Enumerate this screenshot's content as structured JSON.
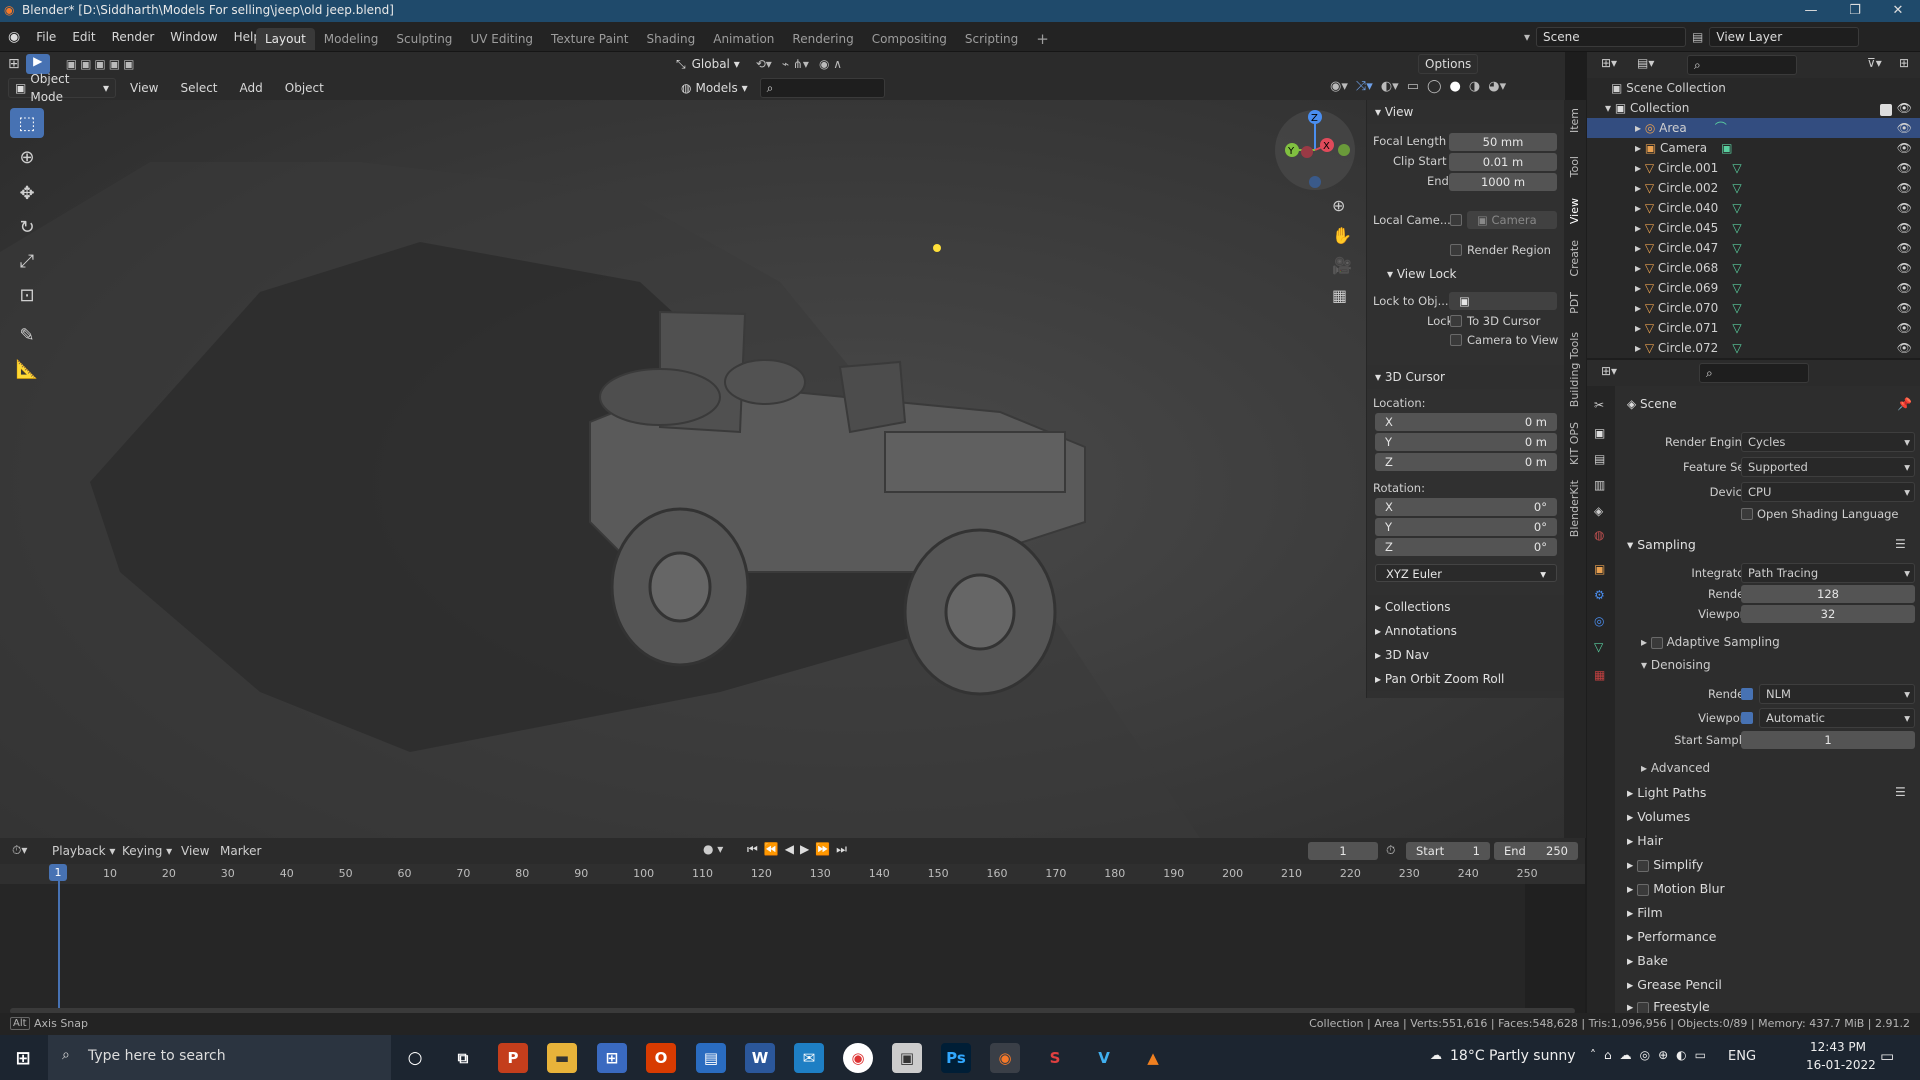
{
  "window": {
    "title": "Blender* [D:\\Siddharth\\Models For selling\\jeep\\old jeep.blend]"
  },
  "menu": [
    "File",
    "Edit",
    "Render",
    "Window",
    "Help"
  ],
  "workspaces": [
    "Layout",
    "Modeling",
    "Sculpting",
    "UV Editing",
    "Texture Paint",
    "Shading",
    "Animation",
    "Rendering",
    "Compositing",
    "Scripting"
  ],
  "top_right": {
    "scene": "Scene",
    "view_layer": "View Layer"
  },
  "viewport_header": {
    "transform_orientation": "Global",
    "options": "Options",
    "mode": "Object Mode",
    "menus": [
      "View",
      "Select",
      "Add",
      "Object"
    ],
    "asset_lib": "Models"
  },
  "npanel": {
    "tabs": [
      "Item",
      "Tool",
      "View",
      "Create",
      "PDT",
      "Building Tools",
      "KIT OPS",
      "BlenderKit"
    ],
    "view_header": "View",
    "focal_length_label": "Focal Length",
    "focal_length": "50 mm",
    "clip_start_label": "Clip Start",
    "clip_start": "0.01 m",
    "end_label": "End",
    "end": "1000 m",
    "local_camera_label": "Local Came...",
    "local_camera": "Camera",
    "render_region": "Render Region",
    "view_lock_header": "View Lock",
    "lock_to_obj": "Lock to Obj...",
    "lock_label": "Lock",
    "to_3d_cursor": "To 3D Cursor",
    "camera_to_view": "Camera to View",
    "cursor_header": "3D Cursor",
    "location_label": "Location:",
    "loc_x": "0 m",
    "loc_y": "0 m",
    "loc_z": "0 m",
    "rotation_label": "Rotation:",
    "rot_x": "0°",
    "rot_y": "0°",
    "rot_z": "0°",
    "rotation_mode": "XYZ Euler",
    "axis_x": "X",
    "axis_y": "Y",
    "axis_z": "Z",
    "collapsed": [
      "Collections",
      "Annotations",
      "3D Nav",
      "Pan Orbit Zoom Roll"
    ]
  },
  "outliner": {
    "root": "Scene Collection",
    "collection": "Collection",
    "items": [
      "Area",
      "Camera",
      "Circle.001",
      "Circle.002",
      "Circle.040",
      "Circle.045",
      "Circle.047",
      "Circle.068",
      "Circle.069",
      "Circle.070",
      "Circle.071",
      "Circle.072"
    ]
  },
  "properties": {
    "scene": "Scene",
    "render_engine_label": "Render Engine",
    "render_engine": "Cycles",
    "feature_set_label": "Feature Set",
    "feature_set": "Supported",
    "device_label": "Device",
    "device": "CPU",
    "open_shading": "Open Shading Language",
    "sampling": "Sampling",
    "integrator_label": "Integrator",
    "integrator": "Path Tracing",
    "render_label": "Render",
    "render_samples": "128",
    "viewport_label": "Viewport",
    "viewport_samples": "32",
    "adaptive": "Adaptive Sampling",
    "denoising": "Denoising",
    "den_render_label": "Render",
    "den_render": "NLM",
    "den_viewport_label": "Viewport",
    "den_viewport": "Automatic",
    "start_sample_label": "Start Sample",
    "start_sample": "1",
    "advanced": "Advanced",
    "sections": [
      "Light Paths",
      "Volumes",
      "Hair",
      "Simplify",
      "Motion Blur",
      "Film",
      "Performance",
      "Bake",
      "Grease Pencil",
      "Freestyle"
    ]
  },
  "timeline": {
    "menus": [
      "Playback",
      "Keying",
      "View",
      "Marker"
    ],
    "current_frame": "1",
    "start_label": "Start",
    "start": "1",
    "end_label": "End",
    "end": "250",
    "ticks": [
      "1",
      "10",
      "20",
      "30",
      "40",
      "50",
      "60",
      "70",
      "80",
      "90",
      "100",
      "110",
      "120",
      "130",
      "140",
      "150",
      "160",
      "170",
      "180",
      "190",
      "200",
      "210",
      "220",
      "230",
      "240",
      "250"
    ]
  },
  "status": {
    "left": "Axis Snap",
    "right": "Collection | Area | Verts:551,616 | Faces:548,628 | Tris:1,096,956 | Objects:0/89 | Memory: 437.7 MiB | 2.91.2"
  },
  "taskbar": {
    "search": "Type here to search",
    "weather": "18°C  Partly sunny",
    "lang": "ENG",
    "time": "12:43 PM",
    "date": "16-01-2022"
  },
  "colors": {
    "accent": "#4772b3",
    "titlebar": "#1f4a6b",
    "selected_row": "#334d80"
  }
}
